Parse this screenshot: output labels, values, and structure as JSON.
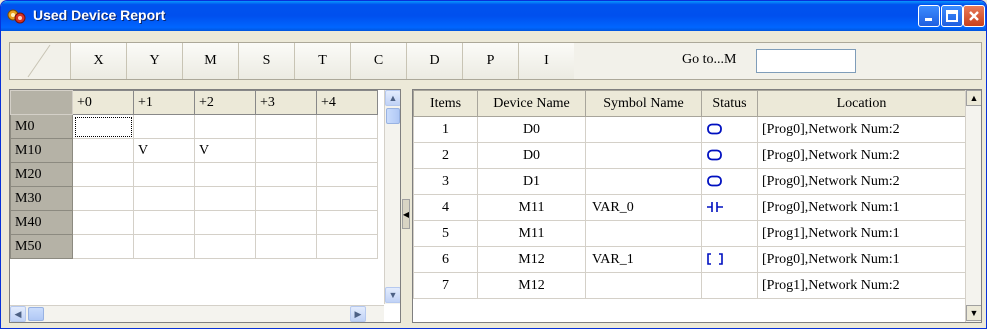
{
  "window": {
    "title": "Used Device Report",
    "accent_color": "#0054e3"
  },
  "device_tabs": [
    "X",
    "Y",
    "M",
    "S",
    "T",
    "C",
    "D",
    "P",
    "I"
  ],
  "goto": {
    "label": "Go to...M",
    "value": ""
  },
  "device_map": {
    "column_headers": [
      "+0",
      "+1",
      "+2",
      "+3",
      "+4"
    ],
    "rows": [
      {
        "label": "M0",
        "cells": [
          "",
          "",
          "",
          "",
          ""
        ]
      },
      {
        "label": "M10",
        "cells": [
          "",
          "V",
          "V",
          "",
          ""
        ]
      },
      {
        "label": "M20",
        "cells": [
          "",
          "",
          "",
          "",
          ""
        ]
      },
      {
        "label": "M30",
        "cells": [
          "",
          "",
          "",
          "",
          ""
        ]
      },
      {
        "label": "M40",
        "cells": [
          "",
          "",
          "",
          "",
          ""
        ]
      },
      {
        "label": "M50",
        "cells": [
          "",
          "",
          "",
          "",
          ""
        ]
      }
    ]
  },
  "usage_table": {
    "headers": [
      "Items",
      "Device Name",
      "Symbol Name",
      "Status",
      "Location"
    ],
    "rows": [
      {
        "item": "1",
        "device": "D0",
        "symbol": "",
        "status_icon": "coil-icon",
        "location": "[Prog0],Network Num:2"
      },
      {
        "item": "2",
        "device": "D0",
        "symbol": "",
        "status_icon": "coil-icon",
        "location": "[Prog0],Network Num:2"
      },
      {
        "item": "3",
        "device": "D1",
        "symbol": "",
        "status_icon": "coil-icon",
        "location": "[Prog0],Network Num:2"
      },
      {
        "item": "4",
        "device": "M11",
        "symbol": "VAR_0",
        "status_icon": "contact-icon",
        "location": "[Prog0],Network Num:1"
      },
      {
        "item": "5",
        "device": "M11",
        "symbol": "",
        "status_icon": "",
        "location": "[Prog1],Network Num:1"
      },
      {
        "item": "6",
        "device": "M12",
        "symbol": "VAR_1",
        "status_icon": "output-coil-bracket-icon",
        "location": "[Prog0],Network Num:1"
      },
      {
        "item": "7",
        "device": "M12",
        "symbol": "",
        "status_icon": "",
        "location": "[Prog1],Network Num:2"
      }
    ]
  }
}
